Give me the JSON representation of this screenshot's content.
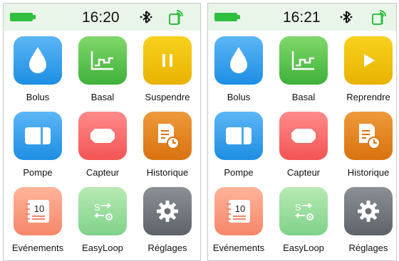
{
  "screens": [
    {
      "time": "16:20",
      "apps": [
        {
          "label": "Bolus",
          "icon": "drop-icon",
          "color": "#1d8ee3"
        },
        {
          "label": "Basal",
          "icon": "basal-chart-icon",
          "color": "#3fb13a"
        },
        {
          "label": "Suspendre",
          "icon": "pause-icon",
          "color": "#e9b200"
        },
        {
          "label": "Pompe",
          "icon": "pump-icon",
          "color": "#1d8ee3"
        },
        {
          "label": "Capteur",
          "icon": "sensor-icon",
          "color": "#f35454"
        },
        {
          "label": "Historique",
          "icon": "history-icon",
          "color": "#d9720f"
        },
        {
          "label": "Evénements",
          "icon": "calendar-icon",
          "color": "#f5866a",
          "icon_text": "10"
        },
        {
          "label": "EasyLoop",
          "icon": "easyloop-icon",
          "color": "#7fd28a"
        },
        {
          "label": "Réglages",
          "icon": "gear-icon",
          "color": "#5e636a"
        }
      ]
    },
    {
      "time": "16:21",
      "apps": [
        {
          "label": "Bolus",
          "icon": "drop-icon",
          "color": "#1d8ee3"
        },
        {
          "label": "Basal",
          "icon": "basal-chart-icon",
          "color": "#3fb13a"
        },
        {
          "label": "Reprendre",
          "icon": "play-icon",
          "color": "#e9b200"
        },
        {
          "label": "Pompe",
          "icon": "pump-icon",
          "color": "#1d8ee3"
        },
        {
          "label": "Capteur",
          "icon": "sensor-icon",
          "color": "#f35454"
        },
        {
          "label": "Historique",
          "icon": "history-icon",
          "color": "#d9720f"
        },
        {
          "label": "Evénements",
          "icon": "calendar-icon",
          "color": "#f5866a",
          "icon_text": "10"
        },
        {
          "label": "EasyLoop",
          "icon": "easyloop-icon",
          "color": "#7fd28a"
        },
        {
          "label": "Réglages",
          "icon": "gear-icon",
          "color": "#5e636a"
        }
      ]
    }
  ],
  "status": {
    "battery_color": "#2fbf3f",
    "bluetooth_icon": "bluetooth-icon",
    "phone_icon": "phone-connected-icon"
  }
}
